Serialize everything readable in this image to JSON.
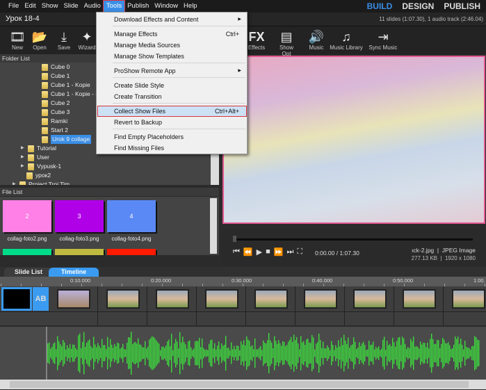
{
  "menu": [
    "File",
    "Edit",
    "Show",
    "Slide",
    "Audio",
    "Tools",
    "Publish",
    "Window",
    "Help"
  ],
  "modes": {
    "build": "BUILD",
    "design": "DESIGN",
    "publish": "PUBLISH",
    "active_color": "#3a8ee6"
  },
  "title": "Урок 18-4",
  "show_info": "11 slides (1:07.30), 1 audio track (2:46.04)",
  "toolbar": [
    {
      "label": "New",
      "icon": "new-show-icon"
    },
    {
      "label": "Open",
      "icon": "open-folder-icon"
    },
    {
      "label": "Save",
      "icon": "save-icon"
    },
    {
      "label": "Wizard",
      "icon": "wizard-icon"
    },
    {
      "label": "Effects",
      "icon": "fx-icon"
    },
    {
      "label": "Show Opt",
      "icon": "show-options-icon"
    },
    {
      "label": "Music",
      "icon": "speaker-icon"
    },
    {
      "label": "Music Library",
      "icon": "music-library-icon"
    },
    {
      "label": "Sync Music",
      "icon": "sync-music-icon"
    }
  ],
  "tools_menu": [
    {
      "label": "Download Effects and Content",
      "submenu": true
    },
    {
      "label": "Manage Effects",
      "shortcut": "Ctrl+"
    },
    {
      "label": "Manage Media Sources"
    },
    {
      "label": "Manage Show Templates"
    },
    {
      "label": "ProShow Remote App",
      "submenu": true
    },
    {
      "label": "Create Slide Style"
    },
    {
      "label": "Create Transition"
    },
    {
      "label": "Collect Show Files",
      "shortcut": "Ctrl+Alt+",
      "highlighted": true
    },
    {
      "label": "Revert to Backup"
    },
    {
      "label": "Find Empty Placeholders"
    },
    {
      "label": "Find Missing Files"
    }
  ],
  "folder_list": {
    "header": "Folder List",
    "items": [
      {
        "label": "Cube 0"
      },
      {
        "label": "Cube 1"
      },
      {
        "label": "Cube 1 - Kopie"
      },
      {
        "label": "Cube 1 - Kopie - K"
      },
      {
        "label": "Cube 2"
      },
      {
        "label": "Cube 3"
      },
      {
        "label": "Ramki"
      },
      {
        "label": "Start 2"
      },
      {
        "label": "Urok 9 collage",
        "selected": true
      },
      {
        "label": "Tutorial",
        "expandable": true
      },
      {
        "label": "User",
        "expandable": true
      },
      {
        "label": "Vypusk-1",
        "expandable": true
      },
      {
        "label": "урок2"
      },
      {
        "label": "Project Troi Tim",
        "expandable": true
      }
    ]
  },
  "file_list": {
    "header": "File List",
    "files": [
      {
        "name": "collag-foto2.png",
        "number": "2",
        "color": "#ff80e6"
      },
      {
        "name": "collag-foto3.png",
        "number": "3",
        "color": "#b000e8"
      },
      {
        "name": "collag-foto4.png",
        "number": "4",
        "color": "#5a88f5"
      }
    ],
    "next_row_colors": [
      "#00dd88",
      "#c0bb40",
      "#ff1a00"
    ]
  },
  "player": {
    "time": "0:00.00 / 1:07.30",
    "file_name": "ıck-2.jpg  |  JPEG Image",
    "file_meta": "277.13 KB  |  1920 x 1080",
    "progress": 0
  },
  "tabs": [
    {
      "label": "Slide List"
    },
    {
      "label": "Timeline",
      "active": true
    }
  ],
  "ruler": [
    "0:10.000",
    "0:20.000",
    "0:30.000",
    "0:40.000",
    "0:50.000",
    "1:00."
  ],
  "transition_label": "AB",
  "waveform_color": "#3ddc3d"
}
